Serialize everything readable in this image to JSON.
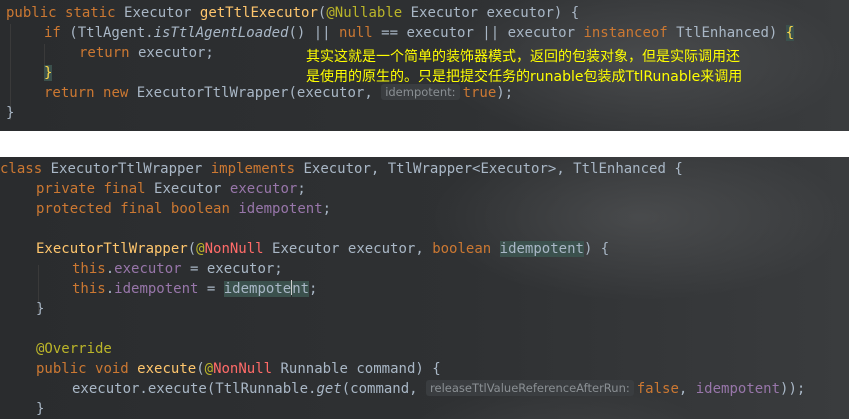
{
  "top_code": {
    "line1": {
      "k1": "public",
      "k2": "static",
      "t1": " Executor ",
      "m": "getTtlExecutor",
      "t2": "(",
      "ann": "@Nullable",
      "t3": " Executor executor) {"
    },
    "line2": {
      "k1": "if",
      "t1": " (TtlAgent.",
      "m": "isTtlAgentLoaded",
      "t2": "() || ",
      "k2": "null",
      "t3": " == executor || executor ",
      "k3": "instanceof",
      "t4": " TtlEnhanced) ",
      "b": "{"
    },
    "line3": {
      "k1": "return",
      "t1": " executor;"
    },
    "line4": {
      "b": "}"
    },
    "line5": {
      "k1": "return",
      "k2": "new",
      "t1": " ExecutorTtlWrapper(executor, ",
      "hint": "idempotent:",
      "k3": "true",
      "t2": ");"
    },
    "line6": {
      "b": "}"
    }
  },
  "note": {
    "line1": "其实这就是一个简单的装饰器模式，返回的包装对象，但是实际调用还",
    "line2": "是使用的原生的。只是把提交任务的runable包装成TtlRunable来调用"
  },
  "bottom_code": {
    "line1": {
      "k1": "class",
      "t1": " ExecutorTtlWrapper ",
      "k2": "implements",
      "t2": " Executor, TtlWrapper<Executor>, TtlEnhanced {"
    },
    "line2": {
      "k1": "private",
      "k2": "final",
      "t1": " Executor ",
      "f": "executor",
      "t2": ";"
    },
    "line3": {
      "k1": "protected",
      "k2": "final",
      "k3": "boolean",
      "f": "idempotent",
      "t2": ";"
    },
    "line4": {
      "m": "ExecutorTtlWrapper",
      "t1": "(",
      "ann": "@",
      "nn": "NonNull",
      "t2": " Executor executor, ",
      "k1": "boolean",
      "hl": "idempotent",
      "t3": ") {"
    },
    "line5": {
      "k1": "this",
      "t1": ".",
      "f": "executor",
      "t2": " = executor;"
    },
    "line6": {
      "k1": "this",
      "t1": ".",
      "f": "idempotent",
      "t2": " = ",
      "hl_a": "idempote",
      "hl_b": "nt",
      "t3": ";"
    },
    "line7": {
      "b": "}"
    },
    "line8": {
      "ann": "@Override"
    },
    "line9": {
      "k1": "public",
      "k2": "void",
      "m": "execute",
      "t1": "(",
      "ann": "@",
      "nn": "NonNull",
      "t2": " Runnable command) {"
    },
    "line10": {
      "t1": "executor.execute(TtlRunnable.",
      "m": "get",
      "t2": "(command, ",
      "hint": "releaseTtlValueReferenceAfterRun:",
      "k1": "false",
      "t3": ", ",
      "hl": "idempotent",
      "t4": "));"
    },
    "line11": {
      "b": "}"
    }
  }
}
